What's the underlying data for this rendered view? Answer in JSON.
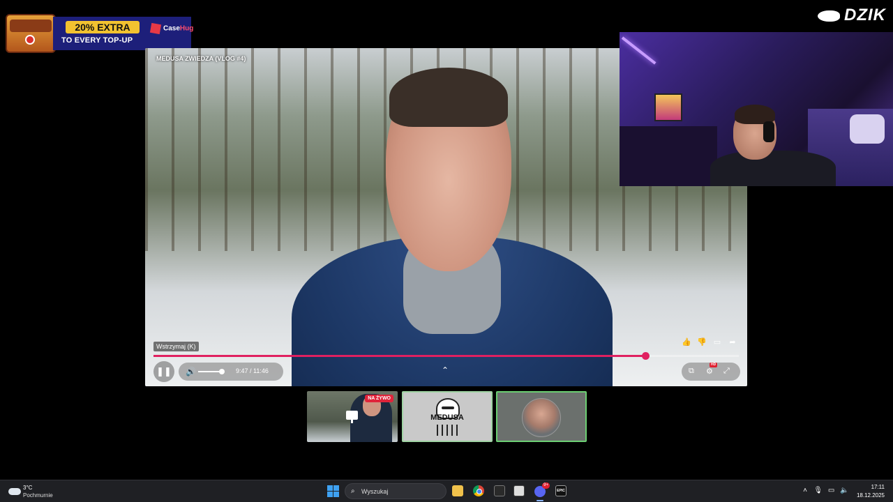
{
  "sponsor": {
    "badge": "20% EXTRA",
    "tagline": "TO EVERY TOP-UP",
    "brand_part1": "Case",
    "brand_part2": "Hug"
  },
  "channel_logo": "DZIK",
  "player": {
    "video_title": "MEDUSA ZWIEDZA (VLOG #4)",
    "pause_tooltip": "Wstrzymaj (K)",
    "time": "9:47 / 11:46",
    "progress": 0.84,
    "volume": 0.85,
    "action_icons": [
      "like-icon",
      "dislike-icon",
      "comment-icon",
      "share-icon"
    ],
    "control_icons": [
      "pause-icon",
      "volume-icon",
      "chevron-up-icon",
      "subtitles-icon",
      "settings-icon",
      "fullscreen-icon"
    ],
    "hd_badge": "HD",
    "colors": {
      "progress": "#e02060"
    }
  },
  "thumbnails": [
    {
      "live_label": "NA ŻYWO"
    },
    {
      "logo_text": "MEDUSA"
    },
    {}
  ],
  "taskbar": {
    "weather_temp": "3°C",
    "weather_cond": "Pochmurnie",
    "search_placeholder": "Wyszukaj",
    "discord_badge": "9+",
    "epic_label": "EPIC",
    "clock_time": "17:11",
    "clock_date": "18.12.2025",
    "tray_icons": [
      "chevron-up-icon",
      "microphone-icon",
      "network-icon",
      "speaker-icon"
    ]
  }
}
